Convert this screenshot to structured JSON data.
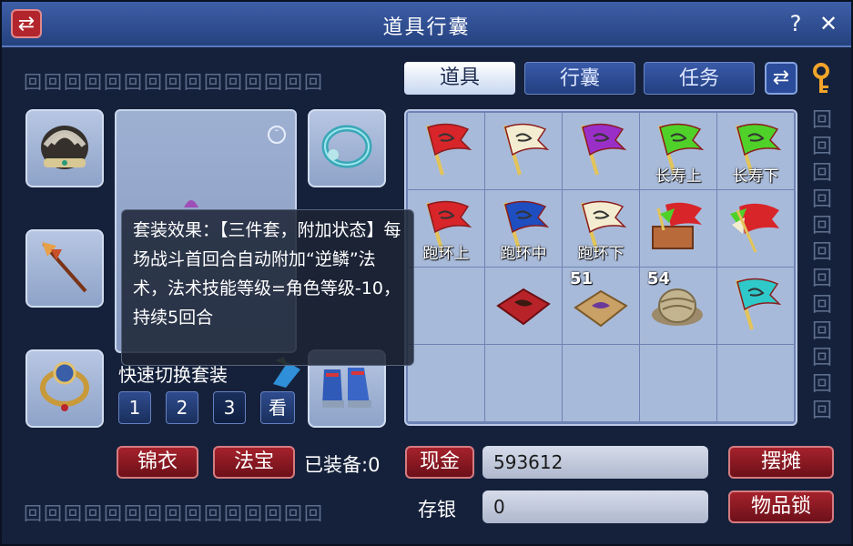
{
  "window": {
    "title": "道具行囊",
    "swap_icon": "⇄",
    "help": "?",
    "close": "✕"
  },
  "fret_pattern": "回回回回回回回回回回回回回回回",
  "tabs": [
    {
      "label": "道具",
      "active": true
    },
    {
      "label": "行囊",
      "active": false
    },
    {
      "label": "任务",
      "active": false
    }
  ],
  "tab_icons": {
    "swap": "⇄",
    "key": "key-icon"
  },
  "equipment": {
    "slots": [
      "helmet-icon",
      "necklace-icon",
      "weapon-icon",
      "ring-icon",
      "armor-icon",
      "boots-icon"
    ],
    "quick_switch_label": "快速切换套装",
    "set_buttons": [
      "1",
      "2",
      "3",
      "看"
    ]
  },
  "tooltip": {
    "text": "套装效果：【三件套，附加状态】每场战斗首回合自动附加“逆鳞”法术，法术技能等级=角色等级-10，持续5回合"
  },
  "inventory": {
    "cells": [
      {
        "icon": "red-flag-icon",
        "label": "",
        "count": ""
      },
      {
        "icon": "white-flag-icon",
        "label": "",
        "count": ""
      },
      {
        "icon": "purple-flag-icon",
        "label": "",
        "count": ""
      },
      {
        "icon": "green-flag-icon",
        "label": "长寿上",
        "count": ""
      },
      {
        "icon": "green-flag-icon",
        "label": "长寿下",
        "count": ""
      },
      {
        "icon": "red-flag-icon",
        "label": "跑环上",
        "count": ""
      },
      {
        "icon": "blue-flag-icon",
        "label": "跑环中",
        "count": ""
      },
      {
        "icon": "white-flag-icon",
        "label": "跑环下",
        "count": ""
      },
      {
        "icon": "flag-chest-icon",
        "label": "",
        "count": ""
      },
      {
        "icon": "flag-bundle-icon",
        "label": "",
        "count": ""
      },
      {
        "icon": "",
        "label": "",
        "count": ""
      },
      {
        "icon": "red-cloth-icon",
        "label": "",
        "count": ""
      },
      {
        "icon": "tan-cloth-icon",
        "label": "",
        "count": "51"
      },
      {
        "icon": "straw-hat-icon",
        "label": "",
        "count": "54"
      },
      {
        "icon": "cyan-flag-icon",
        "label": "",
        "count": ""
      },
      {
        "icon": "",
        "label": "",
        "count": ""
      },
      {
        "icon": "",
        "label": "",
        "count": ""
      },
      {
        "icon": "",
        "label": "",
        "count": ""
      },
      {
        "icon": "",
        "label": "",
        "count": ""
      },
      {
        "icon": "",
        "label": "",
        "count": ""
      }
    ]
  },
  "footer": {
    "jinyi": "锦衣",
    "fabao": "法宝",
    "equipped_label": "已装备:0",
    "cash_button": "现金",
    "cash_value": "593612",
    "stall_button": "摆摊",
    "savings_label": "存银",
    "savings_value": "0",
    "lock_button": "物品锁"
  },
  "colors": {
    "red": "#d8252a",
    "white": "#f4ecd0",
    "purple": "#9a2fc8",
    "green": "#4fd12a",
    "blue": "#1e4ec0",
    "cyan": "#2fc9c9"
  }
}
